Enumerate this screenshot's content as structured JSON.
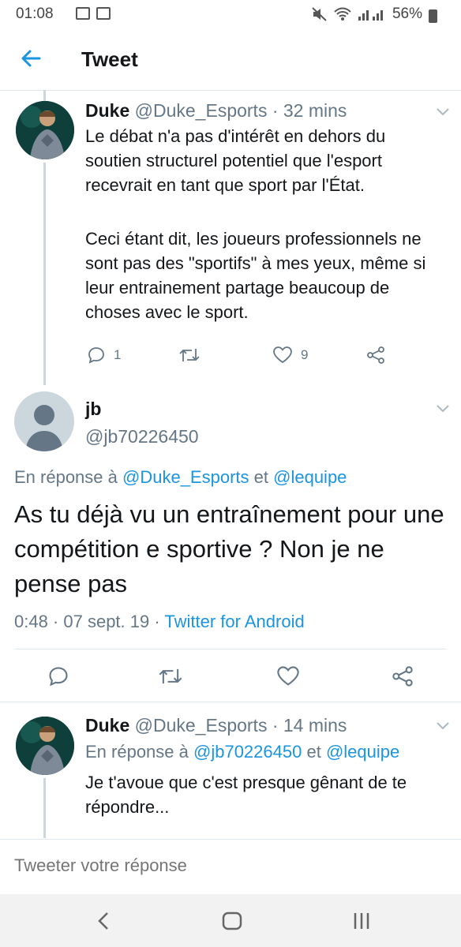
{
  "status_bar": {
    "time": "01:08",
    "battery": "56%"
  },
  "app_bar": {
    "title": "Tweet"
  },
  "tweet1": {
    "name": "Duke",
    "handle": "@Duke_Esports",
    "time": "· 32 mins",
    "paragraph1": "Le débat n'a pas d'intérêt en dehors du soutien structurel potentiel que l'esport recevrait en tant que sport par l'État.",
    "paragraph2": "Ceci étant dit, les joueurs professionnels ne sont pas des \"sportifs\" à mes yeux, même si leur entrainement partage beaucoup de choses avec le sport.",
    "reply_count": "1",
    "like_count": "9"
  },
  "main_tweet": {
    "name": "jb",
    "handle": "@jb70226450",
    "reply_prefix": "En réponse à",
    "reply_to_1": "@Duke_Esports",
    "reply_and": "et",
    "reply_to_2": "@lequipe",
    "text": "As tu déjà vu un entraînement pour une compétition e sportive ? Non je ne pense pas",
    "timestamp": "0:48 · 07 sept. 19 ·",
    "source": "Twitter for Android"
  },
  "tweet3": {
    "name": "Duke",
    "handle": "@Duke_Esports",
    "time": "· 14 mins",
    "reply_prefix": "En réponse à",
    "reply_to_1": "@jb70226450",
    "reply_and": "et",
    "reply_to_2": "@lequipe",
    "text": "Je t'avoue que c'est presque gênant de te répondre..."
  },
  "compose": {
    "placeholder": "Tweeter votre réponse"
  },
  "colors": {
    "accent": "#1b95e0",
    "muted": "#657786",
    "divider": "#e1e8ed",
    "thread": "#ccd6dd",
    "text": "#14171a"
  }
}
